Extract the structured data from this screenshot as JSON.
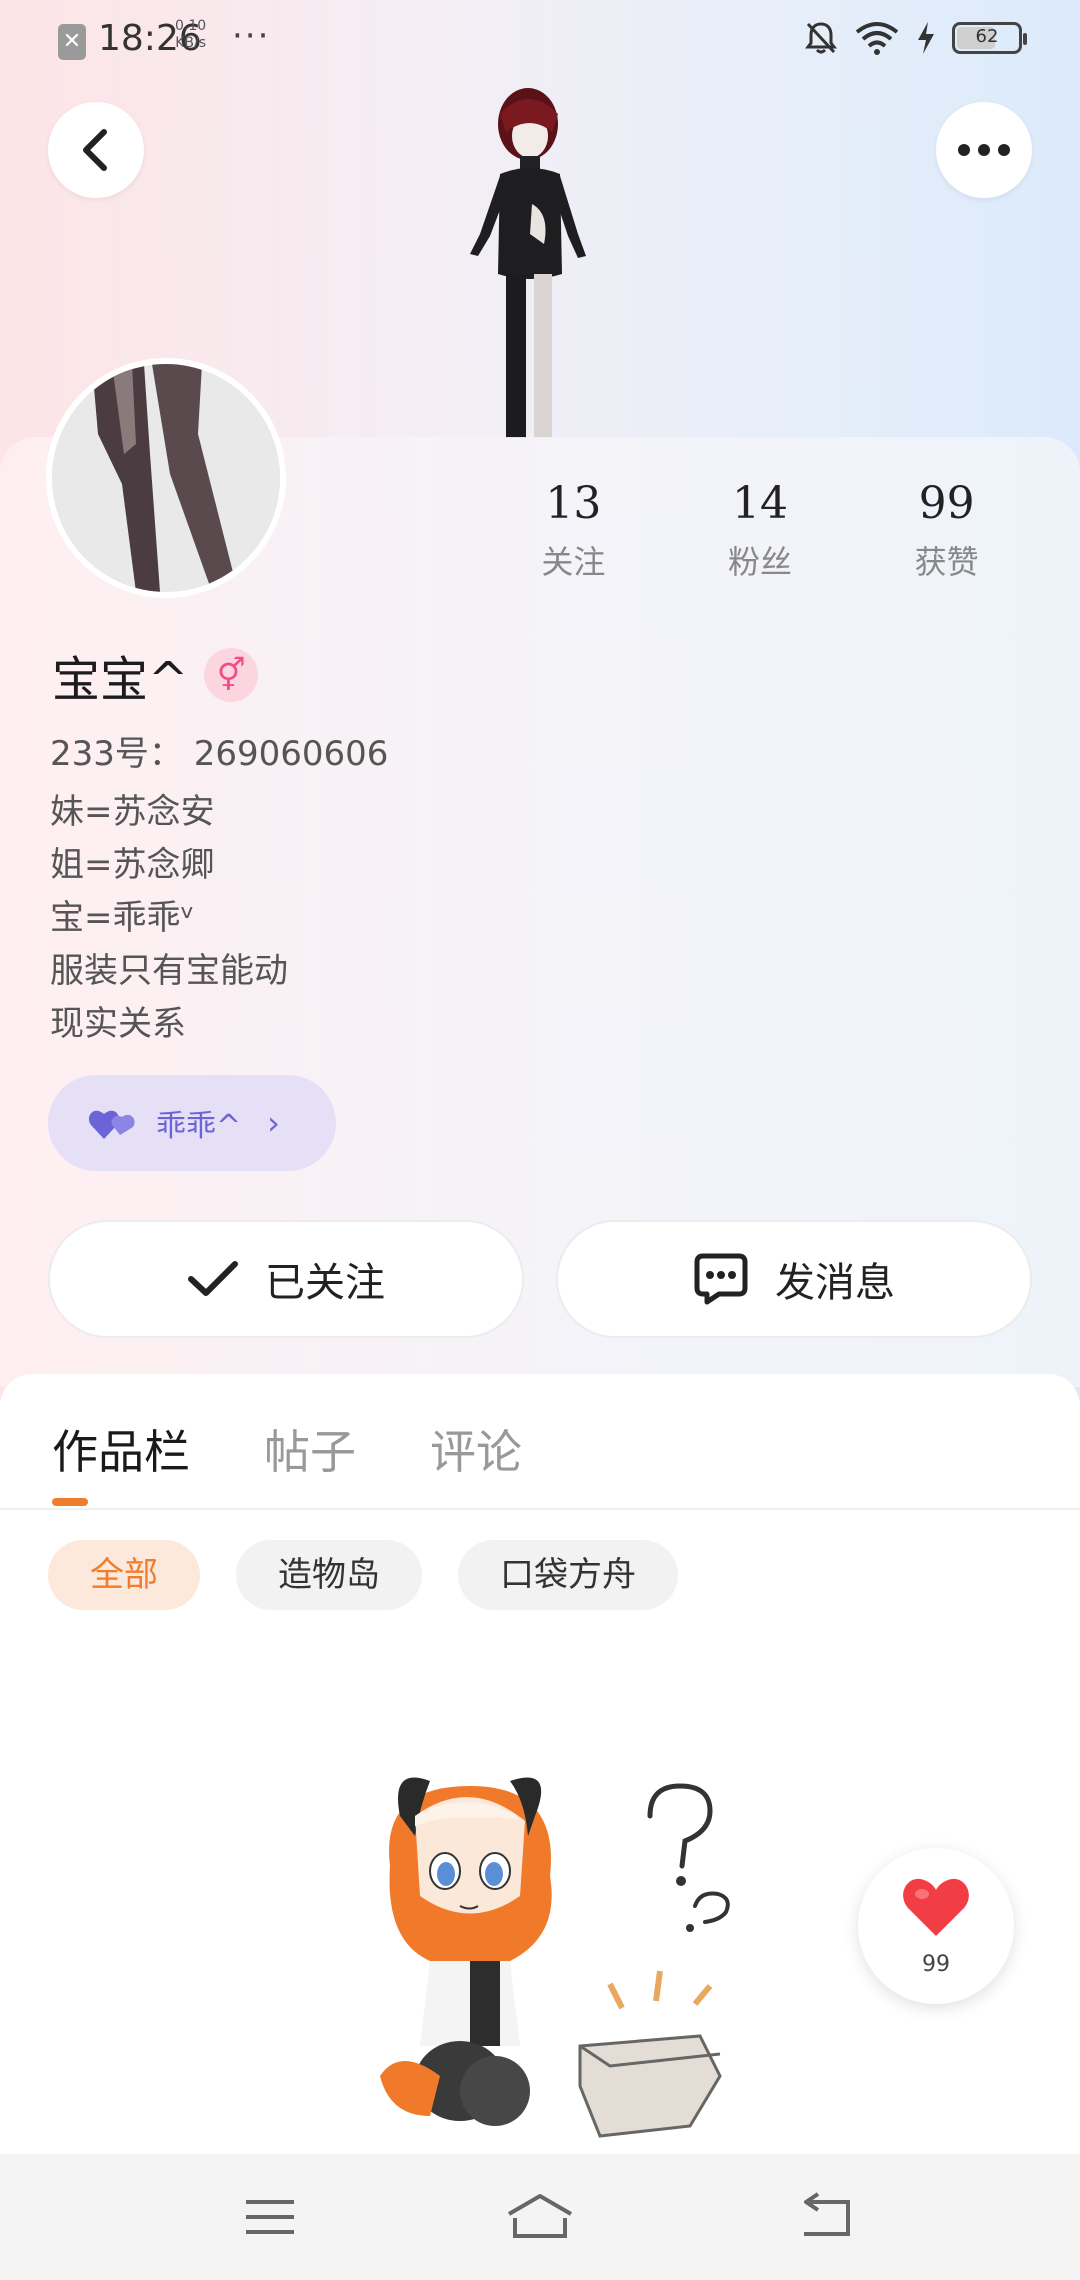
{
  "status_bar": {
    "time": "18:26",
    "speed_value": "0.10",
    "speed_unit": "KB/s",
    "more": "···",
    "battery_level": "62",
    "icons": [
      "close-notification-icon",
      "mute-bell-icon",
      "wifi-icon",
      "charging-icon",
      "battery-icon"
    ]
  },
  "header": {
    "back_icon": "chevron-left-icon",
    "more_icon": "more-horizontal-icon"
  },
  "profile": {
    "stats": [
      {
        "value": "13",
        "label": "关注"
      },
      {
        "value": "14",
        "label": "粉丝"
      },
      {
        "value": "99",
        "label": "获赞"
      }
    ],
    "username": "宝宝^",
    "gender_symbol": "⚥",
    "uid": "233号：  269060606",
    "bio_lines": [
      "妹=苏念安",
      "姐=苏念卿",
      "宝=乖乖ᵛ",
      "服装只有宝能动",
      "现实关系"
    ],
    "relation_name": "乖乖^",
    "relation_chevron": "›"
  },
  "actions": {
    "follow_label": "已关注",
    "message_label": "发消息"
  },
  "tabs": [
    {
      "label": "作品栏",
      "active": true
    },
    {
      "label": "帖子",
      "active": false
    },
    {
      "label": "评论",
      "active": false
    }
  ],
  "chips": [
    {
      "label": "全部",
      "active": true
    },
    {
      "label": "造物岛",
      "active": false
    },
    {
      "label": "口袋方舟",
      "active": false
    }
  ],
  "like_fab": {
    "count": "99"
  },
  "colors": {
    "accent_orange": "#f07d2e",
    "relation_purple": "#6d63d8",
    "gender_pink": "#f04f86"
  }
}
